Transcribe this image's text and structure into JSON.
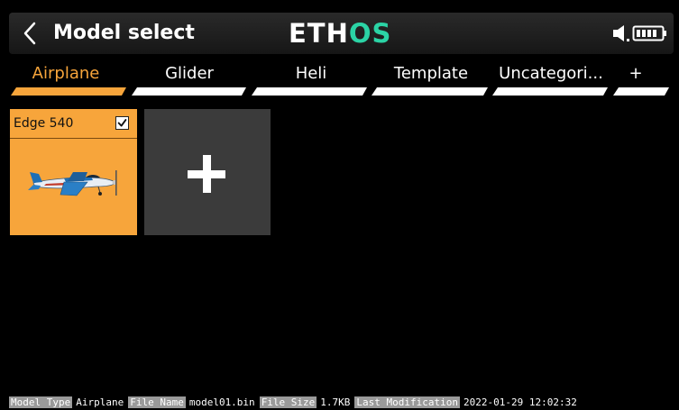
{
  "header": {
    "back_icon": "chevron-left-icon",
    "title": "Model select",
    "logo_part1": "ETH",
    "logo_part2": "OS",
    "speaker_icon": "speaker-icon",
    "battery_icon": "battery-icon"
  },
  "tabs": [
    {
      "label": "Airplane",
      "active": true
    },
    {
      "label": "Glider",
      "active": false
    },
    {
      "label": "Heli",
      "active": false
    },
    {
      "label": "Template",
      "active": false
    },
    {
      "label": "Uncategori...",
      "active": false
    },
    {
      "label": "+",
      "active": false
    }
  ],
  "models": [
    {
      "name": "Edge 540",
      "selected": true,
      "image_icon": "airplane-icon"
    }
  ],
  "add_model_icon": "plus-icon",
  "status": {
    "model_type_label": "Model Type",
    "model_type_value": "Airplane",
    "file_name_label": "File Name",
    "file_name_value": "model01.bin",
    "file_size_label": "File Size",
    "file_size_value": "1.7KB",
    "last_mod_label": "Last Modification",
    "last_mod_value": "2022-01-29 12:02:32"
  },
  "colors": {
    "accent": "#f7a53b",
    "logo_green": "#2bd3a5",
    "background": "#000000",
    "add_tile": "#3b3b3b",
    "status_key_bg": "#9a9a9a"
  }
}
